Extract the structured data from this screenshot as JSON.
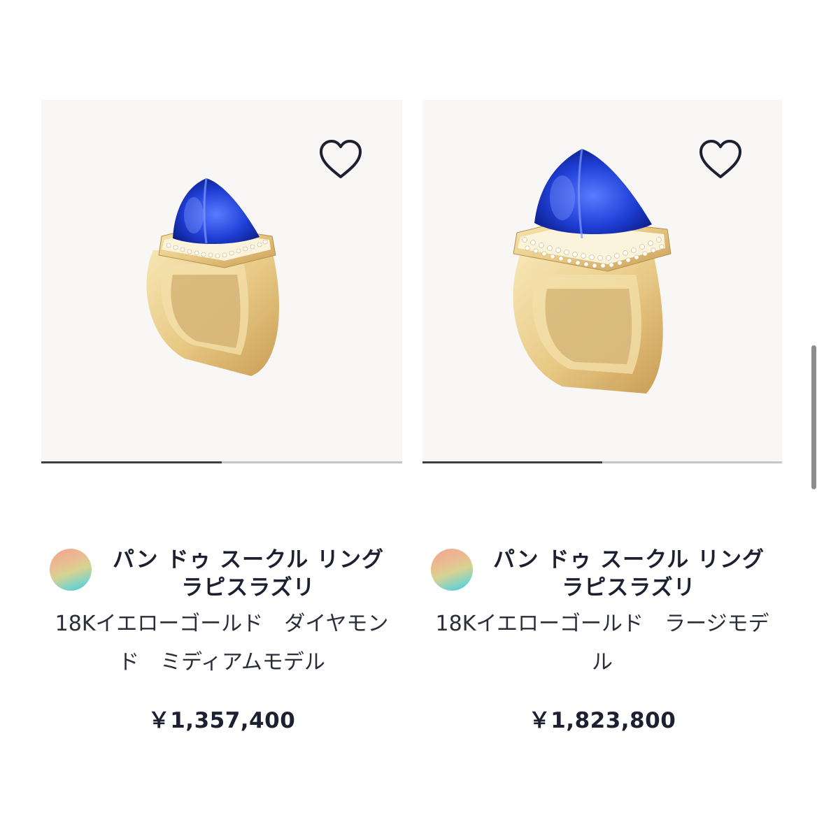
{
  "products": [
    {
      "title": "パン ドゥ スークル リング ラピスラズリ",
      "subtitle": "18Kイエローゴールド　ダイヤモンド　ミディアムモデル",
      "price": "￥1,357,400",
      "image_progress": 0.5,
      "wishlist_icon": "heart-outline-icon"
    },
    {
      "title": "パン ドゥ スークル リング　ラピスラズリ",
      "subtitle": "18Kイエローゴールド　ラージモデル",
      "price": "￥1,823,800",
      "image_progress": 0.5,
      "wishlist_icon": "heart-outline-icon"
    }
  ],
  "colors": {
    "card_background": "#f9f7f6",
    "text": "#1d2030",
    "progress_track": "#c9c4c6",
    "progress_fill": "#3c3e47",
    "gem_blue": "#1f3fd6",
    "gold": "#e9cf8e"
  }
}
